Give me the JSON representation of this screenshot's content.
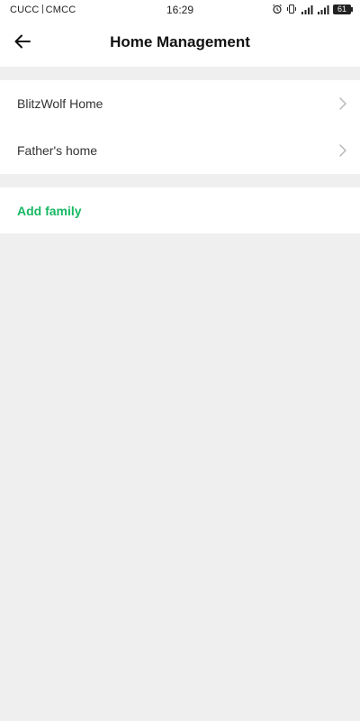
{
  "status_bar": {
    "carrier1": "CUCC",
    "carrier2": "CMCC",
    "time": "16:29",
    "battery": "61",
    "icons": [
      "alarm-icon",
      "vibrate-icon",
      "signal-icon",
      "signal-icon"
    ]
  },
  "header": {
    "title": "Home Management",
    "back_icon": "arrow-left-icon"
  },
  "homes": [
    {
      "label": "BlitzWolf Home",
      "icon": "chevron-right-icon"
    },
    {
      "label": "Father's home",
      "icon": "chevron-right-icon"
    }
  ],
  "add_family": {
    "label": "Add family",
    "color": "#18b864"
  },
  "colors": {
    "background": "#efefef",
    "card": "#ffffff",
    "accent": "#18b864"
  }
}
